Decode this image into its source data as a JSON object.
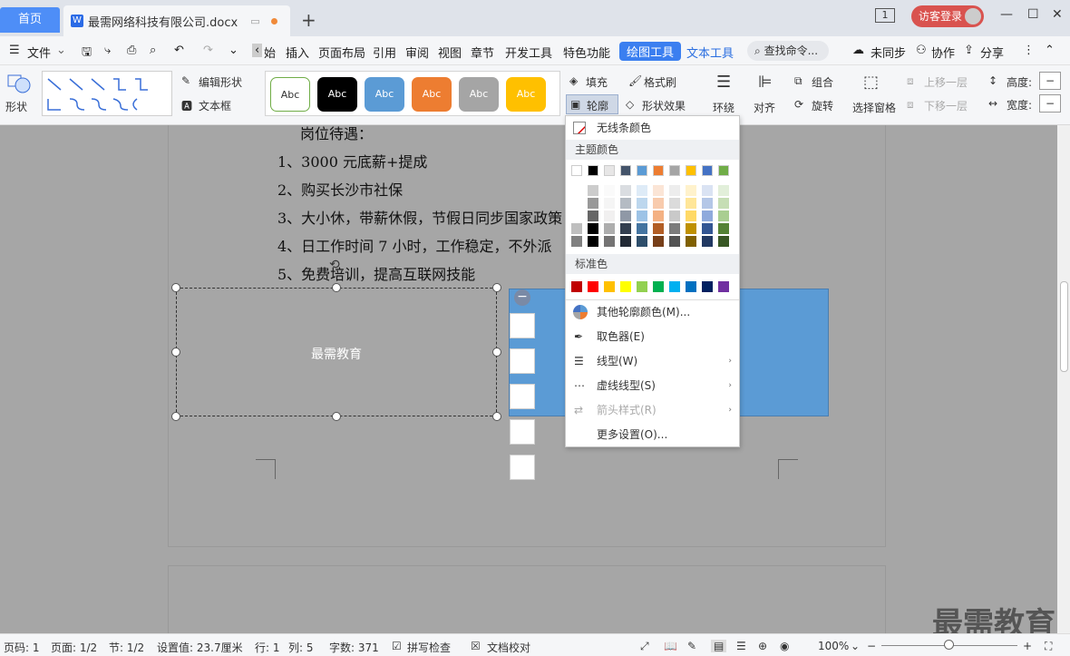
{
  "titlebar": {
    "home_tab": "首页",
    "doc_tab": "最需网络科技有限公司.docx",
    "doc_icon": "W",
    "window_num": "1",
    "visitor": "访客登录"
  },
  "menubar": {
    "file": "文件",
    "items": [
      "始",
      "插入",
      "页面布局",
      "引用",
      "审阅",
      "视图",
      "章节",
      "开发工具",
      "特色功能",
      "绘图工具",
      "文本工具"
    ],
    "search": "查找命令...",
    "unsync": "未同步",
    "collab": "协作",
    "share": "分享"
  },
  "ribbon": {
    "shape": "形状",
    "edit_shape": "编辑形状",
    "textbox": "文本框",
    "style_label": "Abc",
    "fill": "填充",
    "format_brush": "格式刷",
    "outline": "轮廓",
    "shape_effect": "形状效果",
    "wrap": "环绕",
    "align": "对齐",
    "group": "组合",
    "rotate": "旋转",
    "select_pane": "选择窗格",
    "bring_forward": "上移一层",
    "send_backward": "下移一层",
    "height": "高度:",
    "width": "宽度:"
  },
  "document": {
    "lines": [
      "岗位待遇：",
      "1、3000 元底薪+提成",
      "2、购买长沙市社保",
      "3、大小休，带薪休假，节假日同步国家政策",
      "4、日工作时间 7 小时，工作稳定，不外派",
      "5、免费培训，提高互联网技能"
    ],
    "box_text": "最需教育"
  },
  "dropdown": {
    "no_line": "无线条颜色",
    "theme_colors": "主题颜色",
    "standard_colors": "标准色",
    "more_colors": "其他轮廓颜色(M)...",
    "eyedropper": "取色器(E)",
    "line_type": "线型(W)",
    "dash_type": "虚线线型(S)",
    "arrow_style": "箭头样式(R)",
    "more_settings": "更多设置(O)..."
  },
  "theme_row": [
    "#ffffff",
    "#000000",
    "#e7e6e6",
    "#44546a",
    "#5b9bd5",
    "#ed7d31",
    "#a5a5a5",
    "#ffc000",
    "#4472c4",
    "#70ad47"
  ],
  "standard_row": [
    "#c00000",
    "#ff0000",
    "#ffc000",
    "#ffff00",
    "#92d050",
    "#00b050",
    "#00b0f0",
    "#0070c0",
    "#002060",
    "#7030a0"
  ],
  "status": {
    "page": "页码: 1",
    "pages": "页面: 1/2",
    "section": "节: 1/2",
    "setting": "设置值: 23.7厘米",
    "row": "行: 1",
    "col": "列: 5",
    "words": "字数: 371",
    "spell": "拼写检查",
    "proof": "文档校对",
    "zoom": "100%"
  },
  "watermark": "最需教育"
}
